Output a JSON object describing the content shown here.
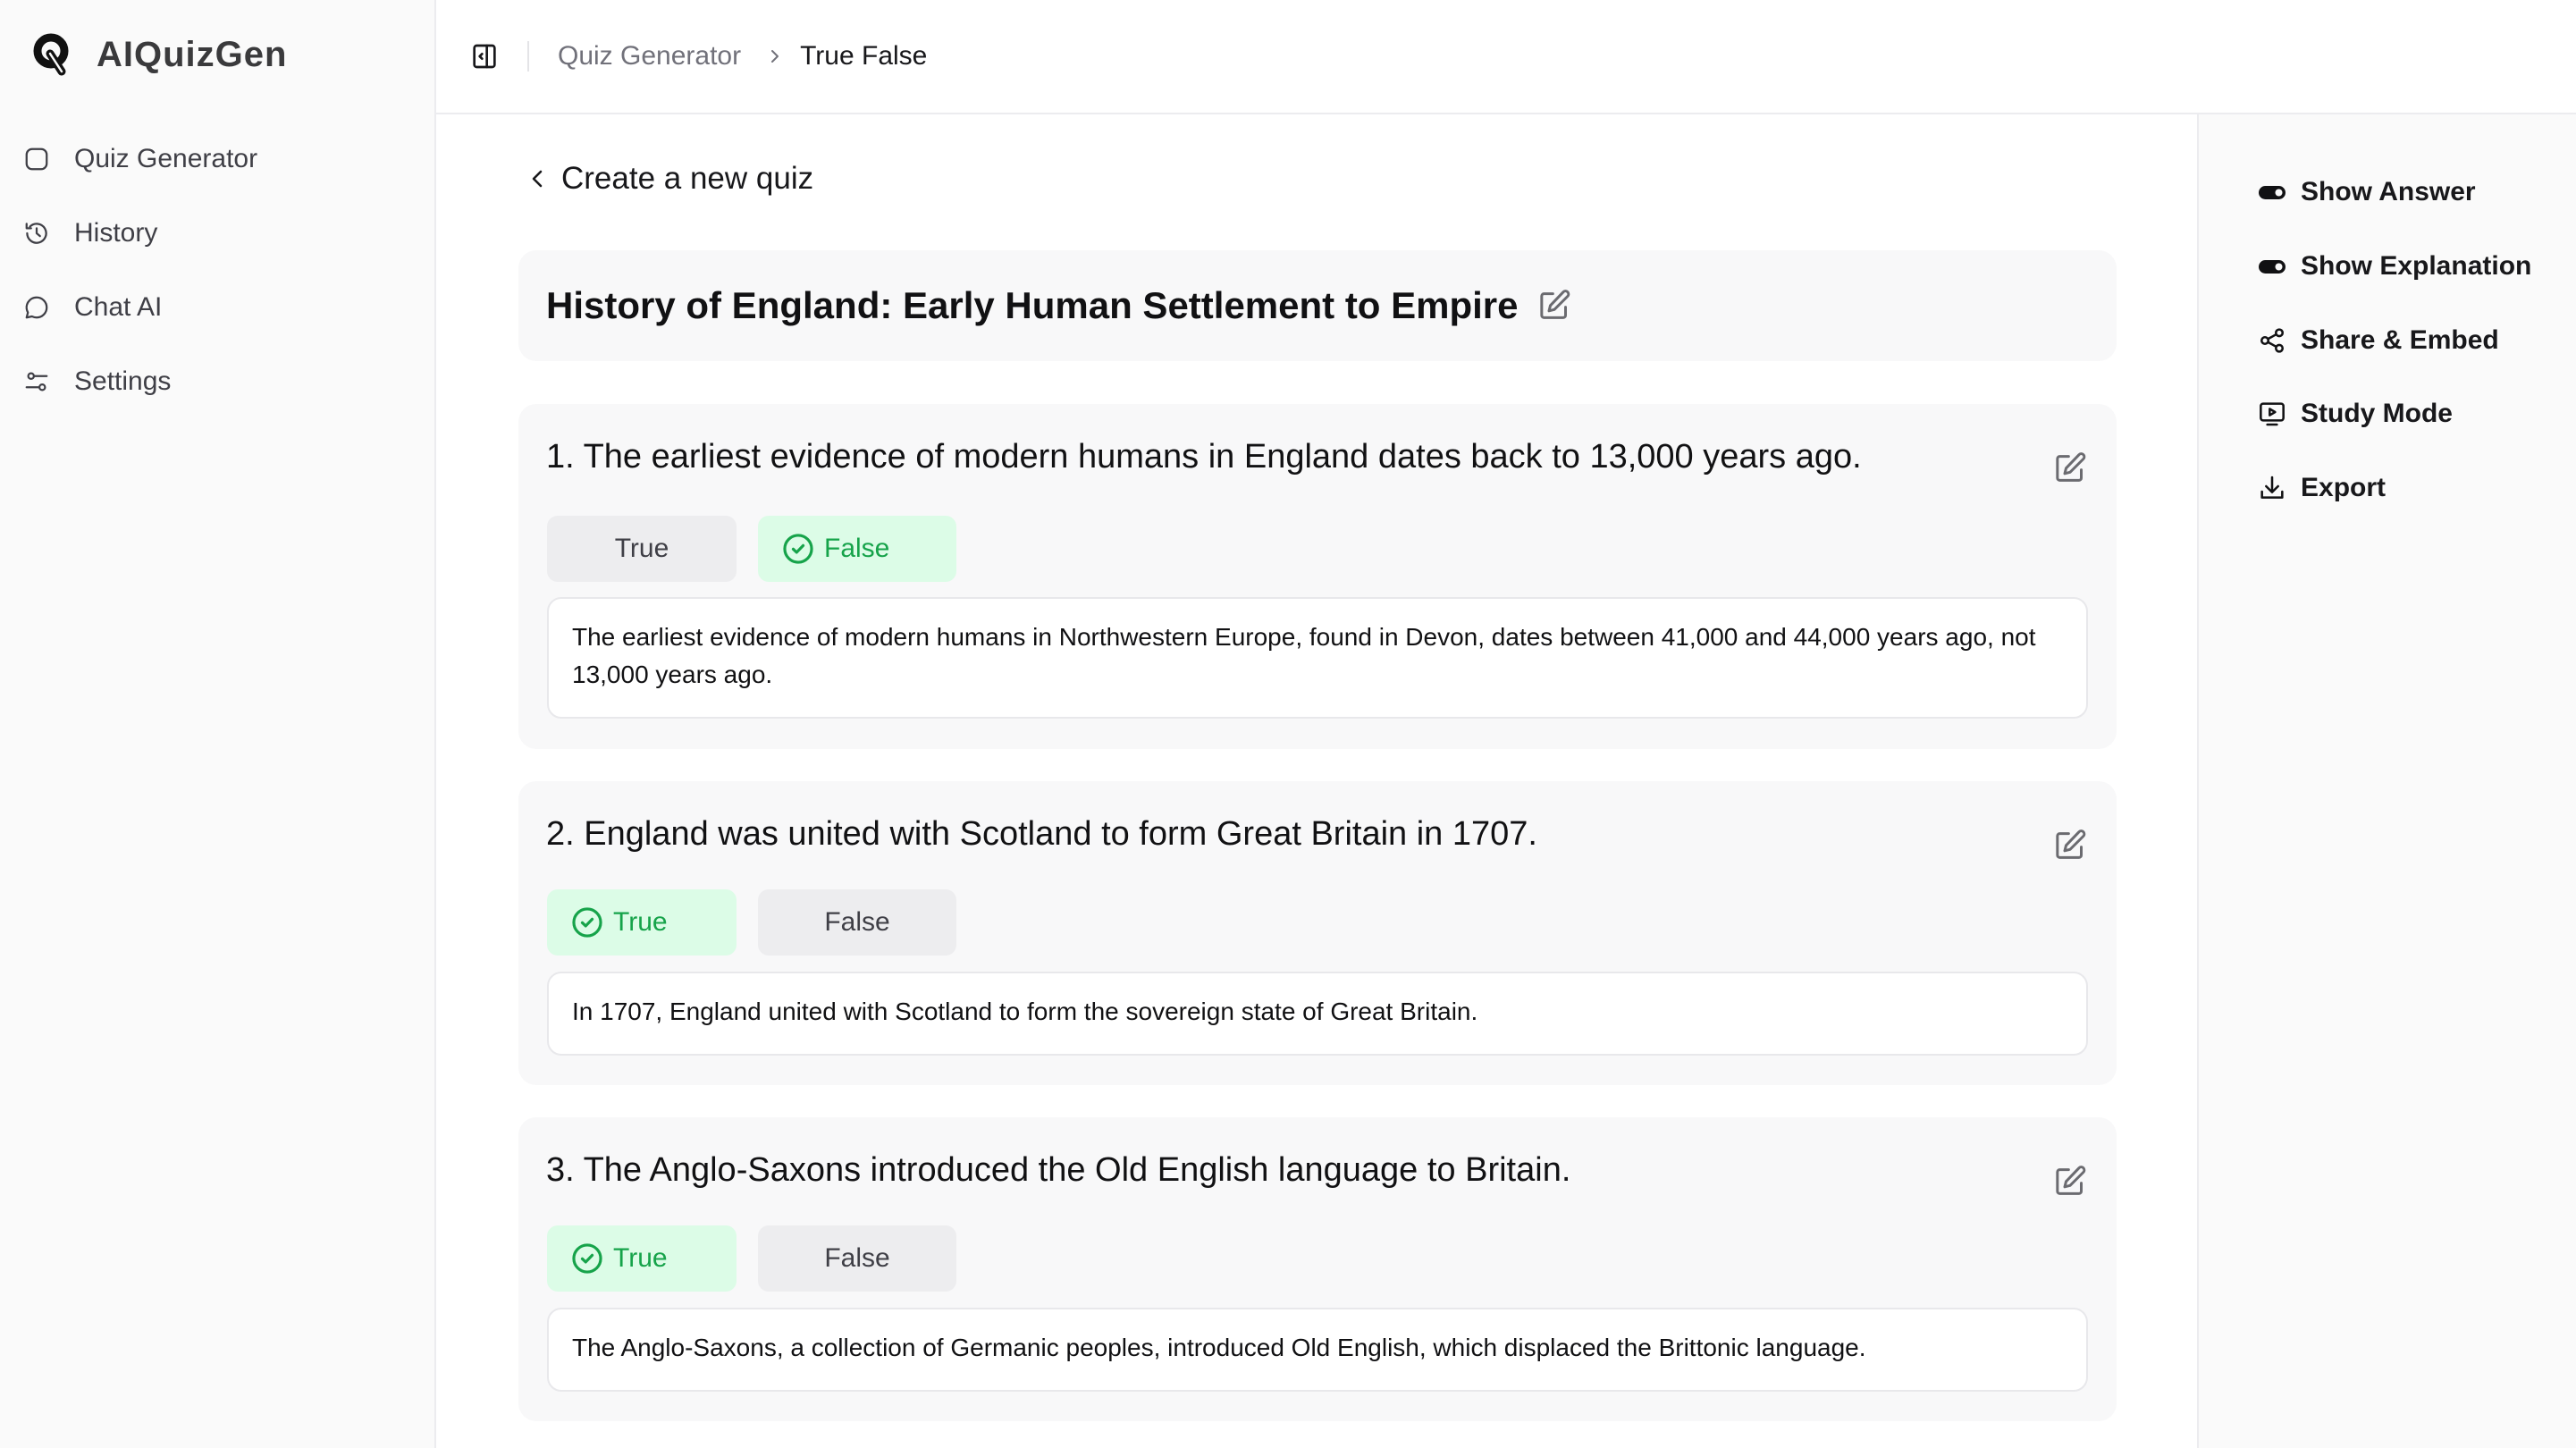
{
  "app": {
    "name": "AIQuizGen"
  },
  "sidebar": {
    "items": [
      {
        "label": "Quiz Generator",
        "icon": "square-icon"
      },
      {
        "label": "History",
        "icon": "history-icon"
      },
      {
        "label": "Chat AI",
        "icon": "chat-bubble-icon"
      },
      {
        "label": "Settings",
        "icon": "sliders-icon"
      }
    ]
  },
  "header": {
    "breadcrumb": [
      "Quiz Generator",
      "True False"
    ]
  },
  "main": {
    "back_label": "Create a new quiz",
    "quiz_title": "History of England: Early Human Settlement to Empire",
    "questions": [
      {
        "number": "1.",
        "text": "1. The earliest evidence of modern humans in England dates back to 13,000 years ago.",
        "options": [
          "True",
          "False"
        ],
        "correct": "False",
        "explanation": "The earliest evidence of modern humans in Northwestern Europe, found in Devon, dates between 41,000 and 44,000 years ago, not 13,000 years ago."
      },
      {
        "number": "2.",
        "text": "2. England was united with Scotland to form Great Britain in 1707.",
        "options": [
          "True",
          "False"
        ],
        "correct": "True",
        "explanation": "In 1707, England united with Scotland to form the sovereign state of Great Britain."
      },
      {
        "number": "3.",
        "text": "3. The Anglo-Saxons introduced the Old English language to Britain.",
        "options": [
          "True",
          "False"
        ],
        "correct": "True",
        "explanation": "The Anglo-Saxons, a collection of Germanic peoples, introduced Old English, which displaced the Brittonic language."
      }
    ]
  },
  "right_panel": {
    "actions": [
      {
        "label": "Show Answer",
        "icon": "toggle-on-icon",
        "state": "on"
      },
      {
        "label": "Show Explanation",
        "icon": "toggle-on-icon",
        "state": "on"
      },
      {
        "label": "Share & Embed",
        "icon": "share-icon"
      },
      {
        "label": "Study Mode",
        "icon": "presentation-play-icon"
      },
      {
        "label": "Export",
        "icon": "download-icon"
      }
    ]
  },
  "colors": {
    "correct_bg": "#dcfce7",
    "correct_text": "#16a34a",
    "neutral_bg": "#ededef",
    "card_bg": "#f8f8f9",
    "sidebar_bg": "#fafafa"
  }
}
